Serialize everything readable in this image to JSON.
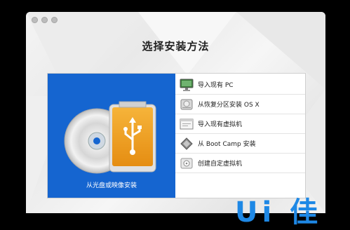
{
  "window": {
    "title": "选择安装方法"
  },
  "left_card": {
    "label": "从光盘或映像安装",
    "icon": "disc-usb-icon"
  },
  "options": [
    {
      "label": "导入现有 PC",
      "icon": "pc-monitor-icon"
    },
    {
      "label": "从恢复分区安装 OS X",
      "icon": "hard-drive-icon"
    },
    {
      "label": "导入现有虚拟机",
      "icon": "vm-window-icon"
    },
    {
      "label": "从 Boot Camp 安装",
      "icon": "boot-camp-icon"
    },
    {
      "label": "创建自定虚拟机",
      "icon": "custom-disk-icon"
    }
  ],
  "watermark": {
    "text": "Ui 佳"
  },
  "colors": {
    "accent_blue": "#1565d0",
    "usb_orange": "#f2a21f",
    "watermark_blue": "#1e88e5"
  }
}
